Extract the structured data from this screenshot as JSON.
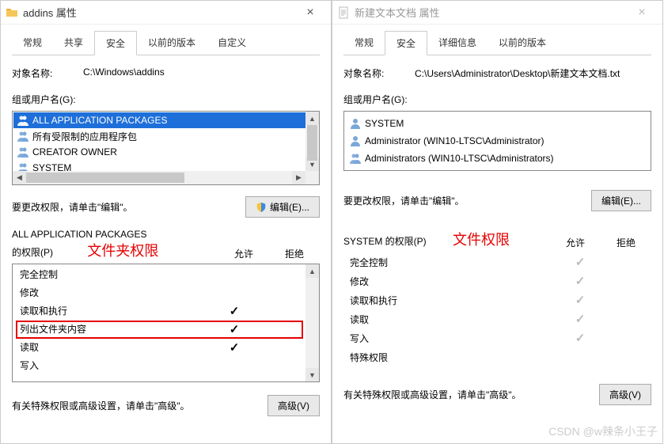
{
  "left": {
    "title": "addins 属性",
    "tabs": [
      "常规",
      "共享",
      "安全",
      "以前的版本",
      "自定义"
    ],
    "active_tab_index": 2,
    "label_object": "对象名称:",
    "object_path": "C:\\Windows\\addins",
    "label_group": "组或用户名(G):",
    "principals": [
      {
        "icon": "double-icon",
        "name": "ALL APPLICATION PACKAGES",
        "selected": true
      },
      {
        "icon": "double-icon",
        "name": "所有受限制的应用程序包",
        "selected": false
      },
      {
        "icon": "double-icon",
        "name": "CREATOR OWNER",
        "selected": false
      },
      {
        "icon": "double-icon",
        "name": "SYSTEM",
        "selected": false
      }
    ],
    "label_edit": "要更改权限，请单击\"编辑\"。",
    "btn_edit": "编辑(E)...",
    "perm_title_line1": "ALL APPLICATION PACKAGES",
    "perm_title_line2": "的权限(P)",
    "annot": "文件夹权限",
    "col_allow": "允许",
    "col_deny": "拒绝",
    "permissions": [
      {
        "name": "完全控制",
        "allow": false
      },
      {
        "name": "修改",
        "allow": false
      },
      {
        "name": "读取和执行",
        "allow": true
      },
      {
        "name": "列出文件夹内容",
        "allow": true,
        "highlight": true
      },
      {
        "name": "读取",
        "allow": true
      },
      {
        "name": "写入",
        "allow": false
      }
    ],
    "label_adv": "有关特殊权限或高级设置，请单击\"高级\"。",
    "btn_adv": "高级(V)"
  },
  "right": {
    "title": "新建文本文档 属性",
    "tabs": [
      "常规",
      "安全",
      "详细信息",
      "以前的版本"
    ],
    "active_tab_index": 1,
    "label_object": "对象名称:",
    "object_path": "C:\\Users\\Administrator\\Desktop\\新建文本文档.txt",
    "label_group": "组或用户名(G):",
    "principals": [
      {
        "icon": "user-icon",
        "name": "SYSTEM"
      },
      {
        "icon": "user-icon",
        "name": "Administrator (WIN10-LTSC\\Administrator)"
      },
      {
        "icon": "double-icon",
        "name": "Administrators (WIN10-LTSC\\Administrators)"
      }
    ],
    "label_edit": "要更改权限，请单击\"编辑\"。",
    "btn_edit": "编辑(E)...",
    "perm_title": "SYSTEM 的权限(P)",
    "annot": "文件权限",
    "col_allow": "允许",
    "col_deny": "拒绝",
    "permissions": [
      {
        "name": "完全控制",
        "allow_gray": true
      },
      {
        "name": "修改",
        "allow_gray": true
      },
      {
        "name": "读取和执行",
        "allow_gray": true
      },
      {
        "name": "读取",
        "allow_gray": true
      },
      {
        "name": "写入",
        "allow_gray": true
      },
      {
        "name": "特殊权限",
        "allow_gray": false
      }
    ],
    "label_adv": "有关特殊权限或高级设置，请单击\"高级\"。",
    "btn_adv": "高级(V)"
  },
  "watermark": "CSDN @w辣条小王子"
}
